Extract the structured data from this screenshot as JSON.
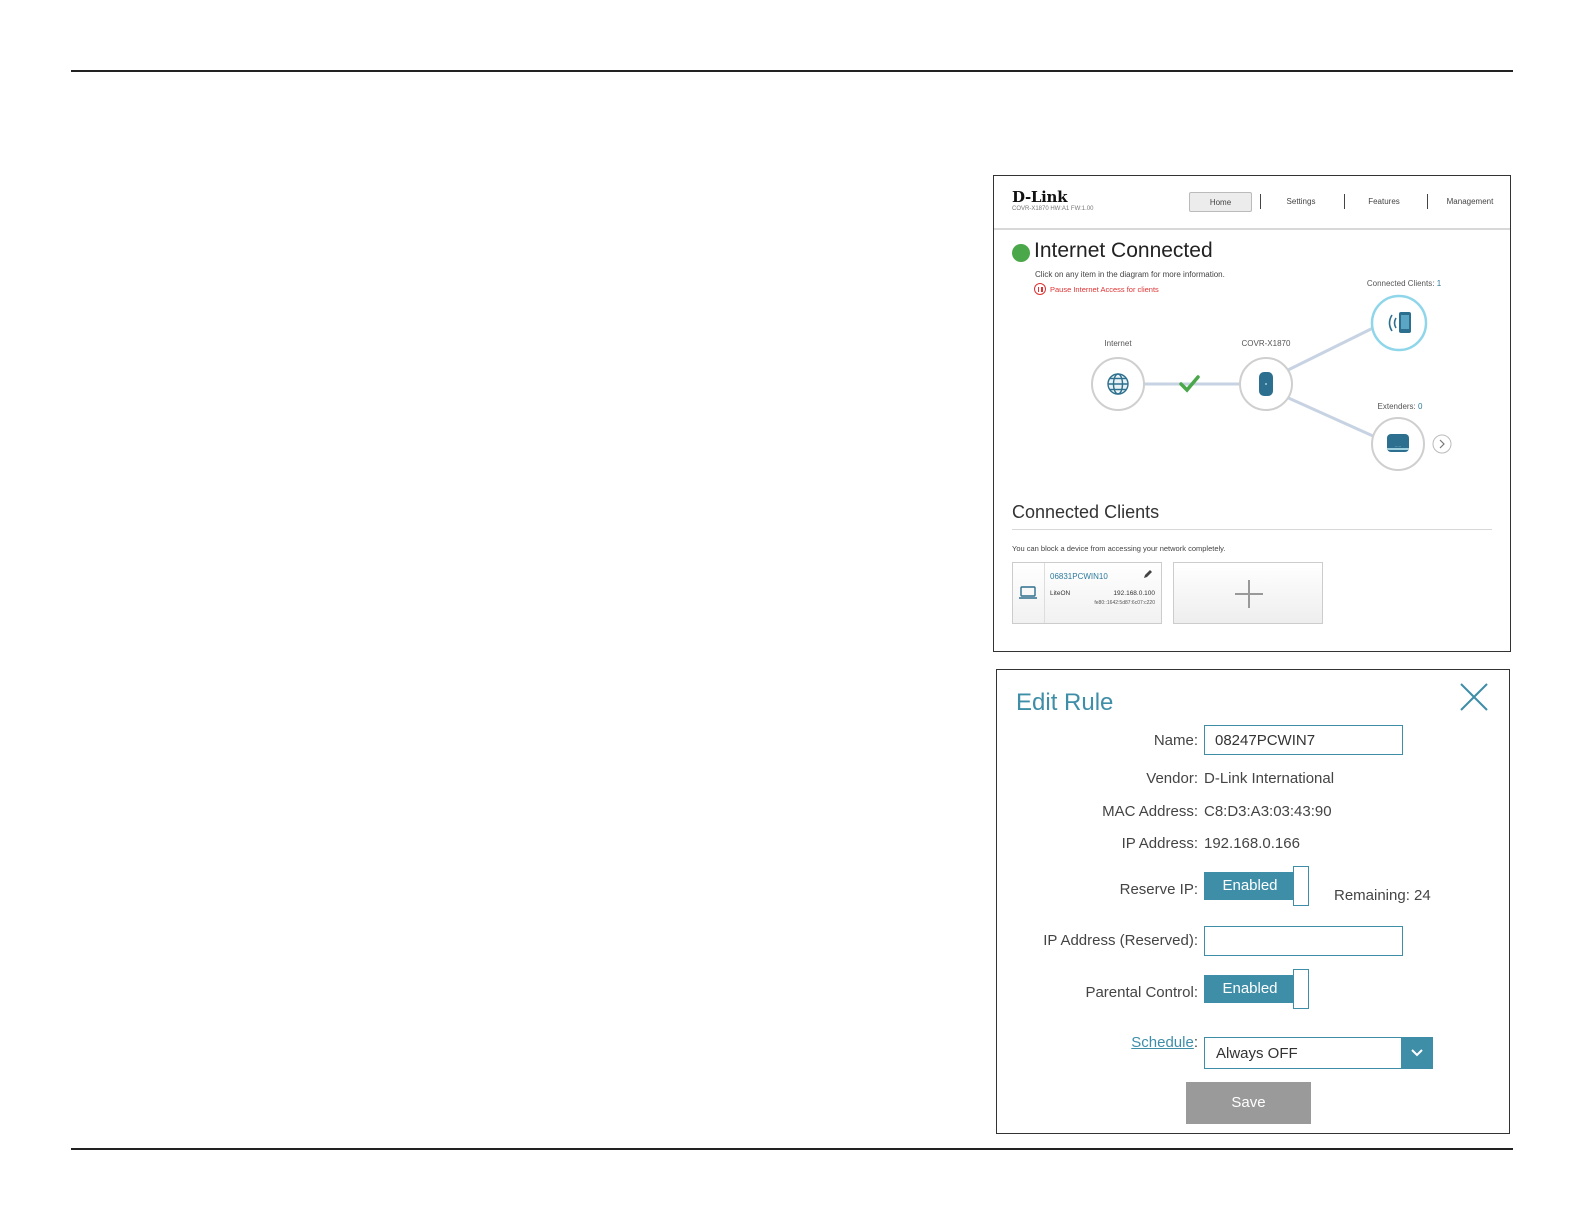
{
  "home": {
    "brand": "D-Link",
    "model_info": "COVR-X1870 HW:A1 FW:1.00",
    "nav": {
      "home": "Home",
      "settings": "Settings",
      "features": "Features",
      "management": "Management"
    },
    "status_title": "Internet Connected",
    "hint": "Click on any item in the diagram for more information.",
    "pause_link": "Pause Internet Access for clients",
    "diagram": {
      "internet_label": "Internet",
      "device_label": "COVR-X1870",
      "clients_label": "Connected Clients:",
      "clients_count": "1",
      "extenders_label": "Extenders:",
      "extenders_count": "0"
    },
    "connected_clients": {
      "title": "Connected Clients",
      "note": "You can block a device from accessing your network completely.",
      "client": {
        "name": "06831PCWIN10",
        "vendor": "LiteON",
        "ip": "192.168.0.100",
        "ipv6": "fe80::1642:5d87:6c07:c220"
      }
    }
  },
  "edit_rule": {
    "title": "Edit Rule",
    "labels": {
      "name": "Name:",
      "vendor": "Vendor:",
      "mac": "MAC Address:",
      "ip": "IP Address:",
      "reserve_ip": "Reserve IP:",
      "ip_reserved": "IP Address (Reserved):",
      "parental": "Parental Control:",
      "schedule": "Schedule",
      "schedule_colon": ":"
    },
    "values": {
      "name": "08247PCWIN7",
      "vendor": "D-Link International",
      "mac": "C8:D3:A3:03:43:90",
      "ip": "192.168.0.166",
      "reserve_ip": "Enabled",
      "remaining": "Remaining: 24",
      "ip_reserved": "",
      "parental": "Enabled",
      "schedule": "Always OFF"
    },
    "save_label": "Save"
  },
  "colors": {
    "accent": "#3f8ea8",
    "connected": "#4aa84a",
    "alert": "#dd3333",
    "save_button": "#9a9a9a"
  }
}
